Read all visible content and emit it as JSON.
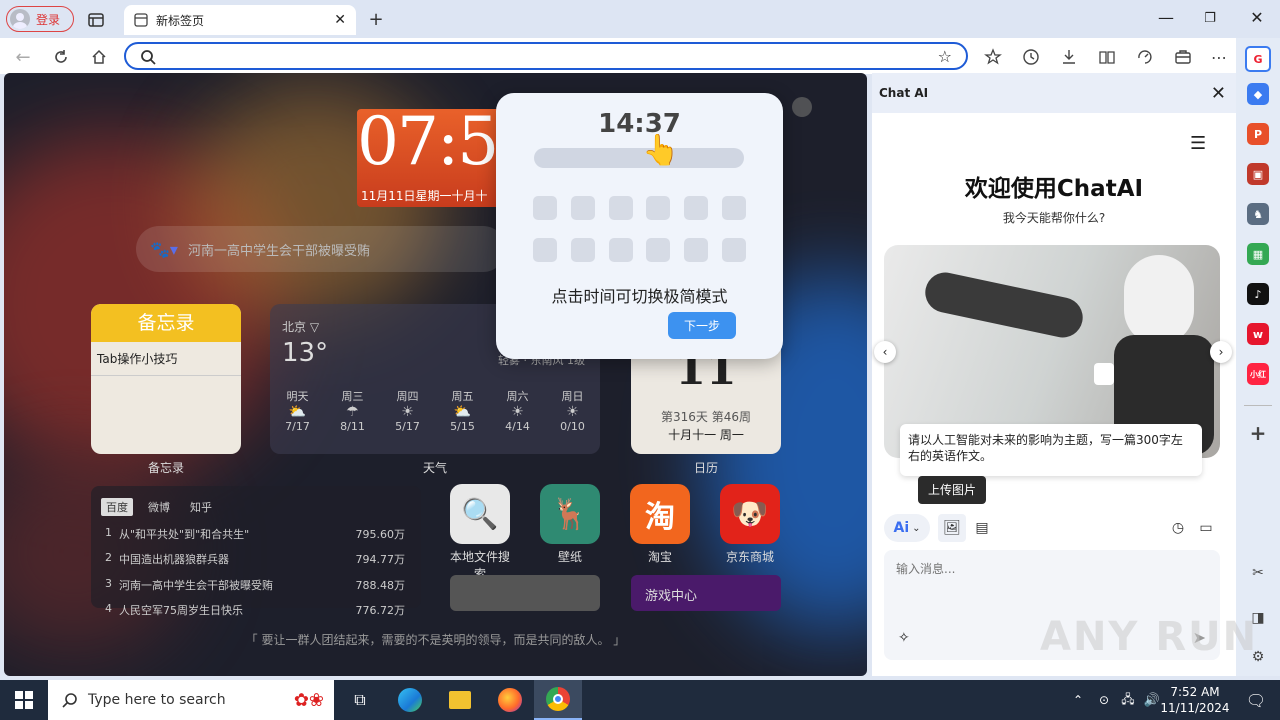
{
  "browser": {
    "profile_label": "登录",
    "tab_title": "新标签页",
    "url_value": "",
    "url_placeholder": ""
  },
  "newtab": {
    "clock_time": "07:52",
    "clock_date": "11月11日星期一十月十",
    "search_text": "河南一高中学生会干部被曝受贿",
    "memo": {
      "header": "备忘录",
      "item": "Tab操作小技巧",
      "label": "备忘录"
    },
    "weather": {
      "city": "北京 ▽",
      "temp": "13°",
      "extra": "轻雾  ·  东南风 1级",
      "label": "天气",
      "days": [
        {
          "day": "明天",
          "range": "7/17"
        },
        {
          "day": "周三",
          "range": "8/11"
        },
        {
          "day": "周四",
          "range": "5/17"
        },
        {
          "day": "周五",
          "range": "5/15"
        },
        {
          "day": "周六",
          "range": "4/14"
        },
        {
          "day": "周日",
          "range": "0/10"
        }
      ]
    },
    "calendar": {
      "day": "11",
      "info": "第316天 第46周",
      "lunar": "十月十一 周一",
      "label": "日历"
    },
    "news": {
      "tabs": [
        "百度",
        "微博",
        "知乎"
      ],
      "rows": [
        {
          "n": "1",
          "title": "从\"和平共处\"到\"和合共生\"",
          "hot": "795.60万"
        },
        {
          "n": "2",
          "title": "中国造出机器狼群兵器",
          "hot": "794.77万"
        },
        {
          "n": "3",
          "title": "河南一高中学生会干部被曝受贿",
          "hot": "788.48万"
        },
        {
          "n": "4",
          "title": "人民空军75周岁生日快乐",
          "hot": "776.72万"
        }
      ]
    },
    "apps": [
      {
        "label": "本地文件搜索"
      },
      {
        "label": "壁纸"
      },
      {
        "label": "淘宝"
      },
      {
        "label": "京东商城"
      }
    ],
    "game_center": "游戏中心",
    "quote": "「 要让一群人团结起来，需要的不是英明的领导，而是共同的敌人。 」"
  },
  "popup": {
    "time": "14:37",
    "message": "点击时间可切换极简模式",
    "next_label": "下一步"
  },
  "chat": {
    "header": "Chat AI",
    "title": "欢迎使用ChatAI",
    "subtitle": "我今天能帮你什么?",
    "prompt_card": "请以人工智能对未来的影响为主题，写一篇300字左右的英语作文。",
    "tooltip": "上传图片",
    "input_placeholder": "输入消息..."
  },
  "taskbar": {
    "search_placeholder": "Type here to search",
    "time": "7:52 AM",
    "date": "11/11/2024"
  },
  "watermark": "ANY RUN"
}
